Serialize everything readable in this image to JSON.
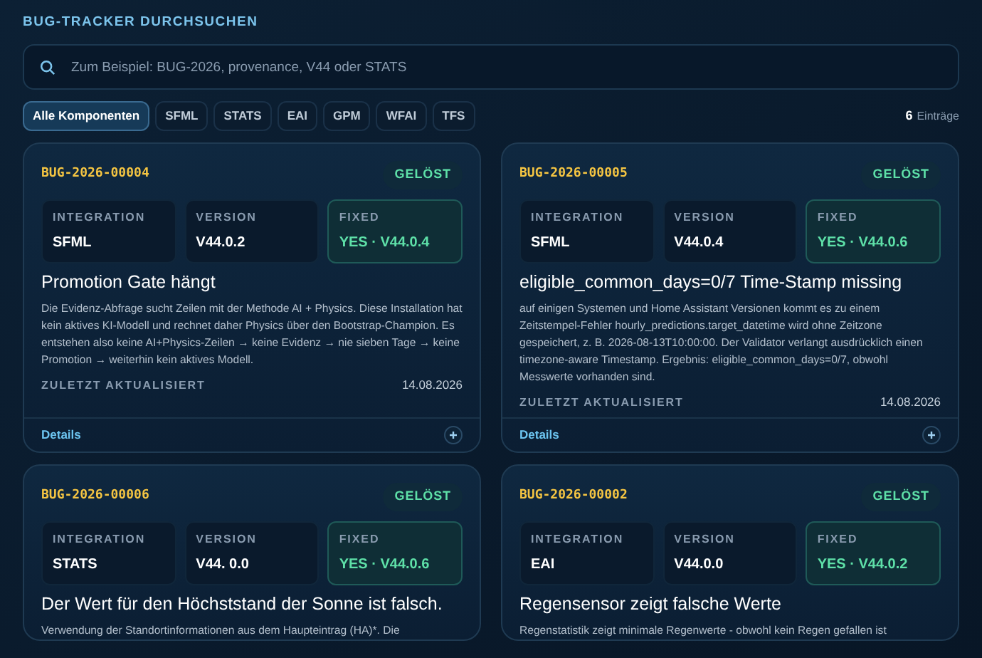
{
  "heading": "BUG-TRACKER DURCHSUCHEN",
  "search": {
    "placeholder": "Zum Beispiel: BUG-2026, provenance, V44 oder STATS"
  },
  "filters": [
    {
      "label": "Alle Komponenten",
      "selected": true
    },
    {
      "label": "SFML",
      "selected": false
    },
    {
      "label": "STATS",
      "selected": false
    },
    {
      "label": "EAI",
      "selected": false
    },
    {
      "label": "GPM",
      "selected": false
    },
    {
      "label": "WFAI",
      "selected": false
    },
    {
      "label": "TFS",
      "selected": false
    }
  ],
  "count": {
    "value": "6",
    "label": "Einträge"
  },
  "cards": [
    {
      "id": "BUG-2026-00004",
      "status": "GELÖST",
      "integration_label": "INTEGRATION",
      "integration": "SFML",
      "version_label": "VERSION",
      "version": "V44.0.2",
      "fixed_label": "FIXED",
      "fixed": "YES · V44.0.4",
      "title": "Promotion Gate hängt",
      "description": "Die Evidenz-Abfrage sucht Zeilen mit der Methode AI + Physics. Diese Installation hat kein aktives KI-Modell und rechnet daher Physics über den Bootstrap-Champion. Es entstehen also keine AI+Physics-Zeilen → keine Evidenz → nie sieben Tage → keine Promotion → weiterhin kein aktives Modell.",
      "updated_label": "ZULETZT AKTUALISIERT",
      "updated": "14.08.2026",
      "details": "Details"
    },
    {
      "id": "BUG-2026-00005",
      "status": "GELÖST",
      "integration_label": "INTEGRATION",
      "integration": "SFML",
      "version_label": "VERSION",
      "version": "V44.0.4",
      "fixed_label": "FIXED",
      "fixed": "YES · V44.0.6",
      "title": "eligible_common_days=0/7 Time-Stamp missing",
      "description": "auf einigen Systemen und Home Assistant Versionen kommt es zu einem Zeitstempel-Fehler hourly_predictions.target_datetime wird ohne Zeitzone gespeichert, z. B. 2026-08-13T10:00:00. Der Validator verlangt ausdrücklich einen timezone-aware Timestamp. Ergebnis: eligible_common_days=0/7, obwohl Messwerte vorhanden sind.",
      "updated_label": "ZULETZT AKTUALISIERT",
      "updated": "14.08.2026",
      "details": "Details"
    },
    {
      "id": "BUG-2026-00006",
      "status": "GELÖST",
      "integration_label": "INTEGRATION",
      "integration": "STATS",
      "version_label": "VERSION",
      "version": "V44. 0.0",
      "fixed_label": "FIXED",
      "fixed": "YES · V44.0.6",
      "title": "Der Wert für den Höchststand der Sonne ist falsch.",
      "description": "Verwendung der Standortinformationen aus dem Haupteintrag (HA)*. Die"
    },
    {
      "id": "BUG-2026-00002",
      "status": "GELÖST",
      "integration_label": "INTEGRATION",
      "integration": "EAI",
      "version_label": "VERSION",
      "version": "V44.0.0",
      "fixed_label": "FIXED",
      "fixed": "YES · V44.0.2",
      "title": "Regensensor zeigt falsche Werte",
      "description": "Regenstatistik zeigt minimale Regenwerte - obwohl kein Regen gefallen ist"
    }
  ]
}
